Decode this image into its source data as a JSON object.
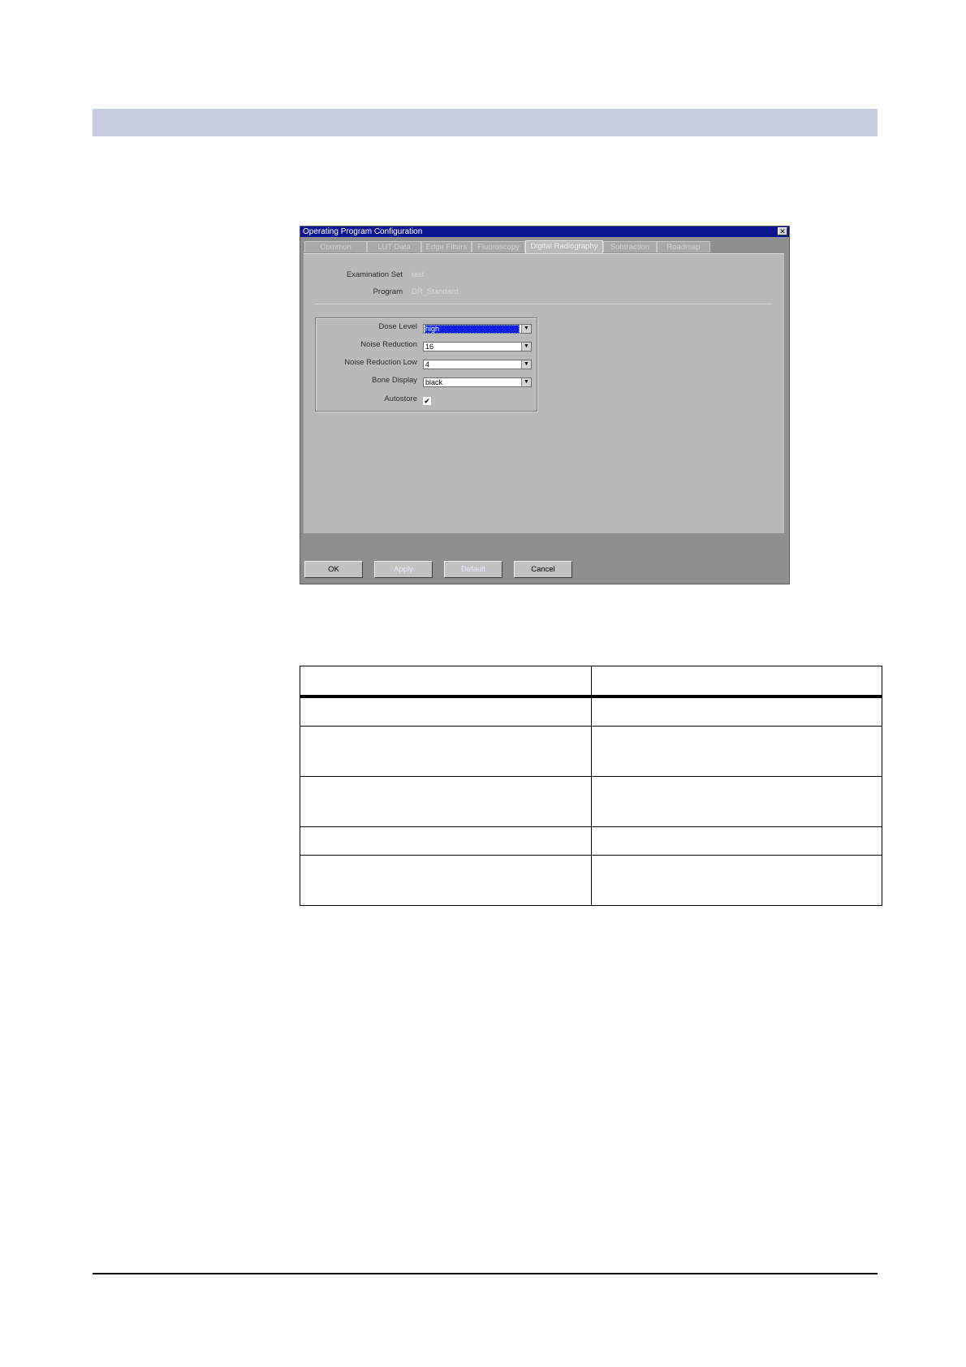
{
  "dialog": {
    "title": "Operating Program Configuration",
    "close_glyph": "✕",
    "tabs": [
      {
        "label": "Common"
      },
      {
        "label": "LUT Data"
      },
      {
        "label": "Edge Filters"
      },
      {
        "label": "Fluoroscopy"
      },
      {
        "label": "Digital Radiography"
      },
      {
        "label": "Subtraction"
      },
      {
        "label": "Roadmap"
      }
    ],
    "active_tab": "Digital Radiography",
    "info": {
      "examination_set_label": "Examination Set",
      "examination_set_value": "test",
      "program_label": "Program",
      "program_value": "DR_Standard"
    },
    "settings": {
      "dose_level_label": "Dose Level",
      "dose_level_value": "high",
      "noise_reduction_label": "Noise Reduction",
      "noise_reduction_value": "16",
      "noise_reduction_low_label": "Noise Reduction Low",
      "noise_reduction_low_value": "4",
      "bone_display_label": "Bone Display",
      "bone_display_value": "black",
      "autostore_label": "Autostore",
      "autostore_checked": true,
      "check_glyph": "✔",
      "arrow_glyph": "▼"
    },
    "buttons": {
      "ok": "OK",
      "apply": "Apply",
      "default": "Default",
      "cancel": "Cancel"
    }
  },
  "colors": {
    "header_band": "#c7ccdf",
    "titlebar": "#0b1590",
    "selection": "#0a20e8",
    "dialog_bg": "#8f8f8f",
    "panel_bg": "#b9b9b9"
  }
}
